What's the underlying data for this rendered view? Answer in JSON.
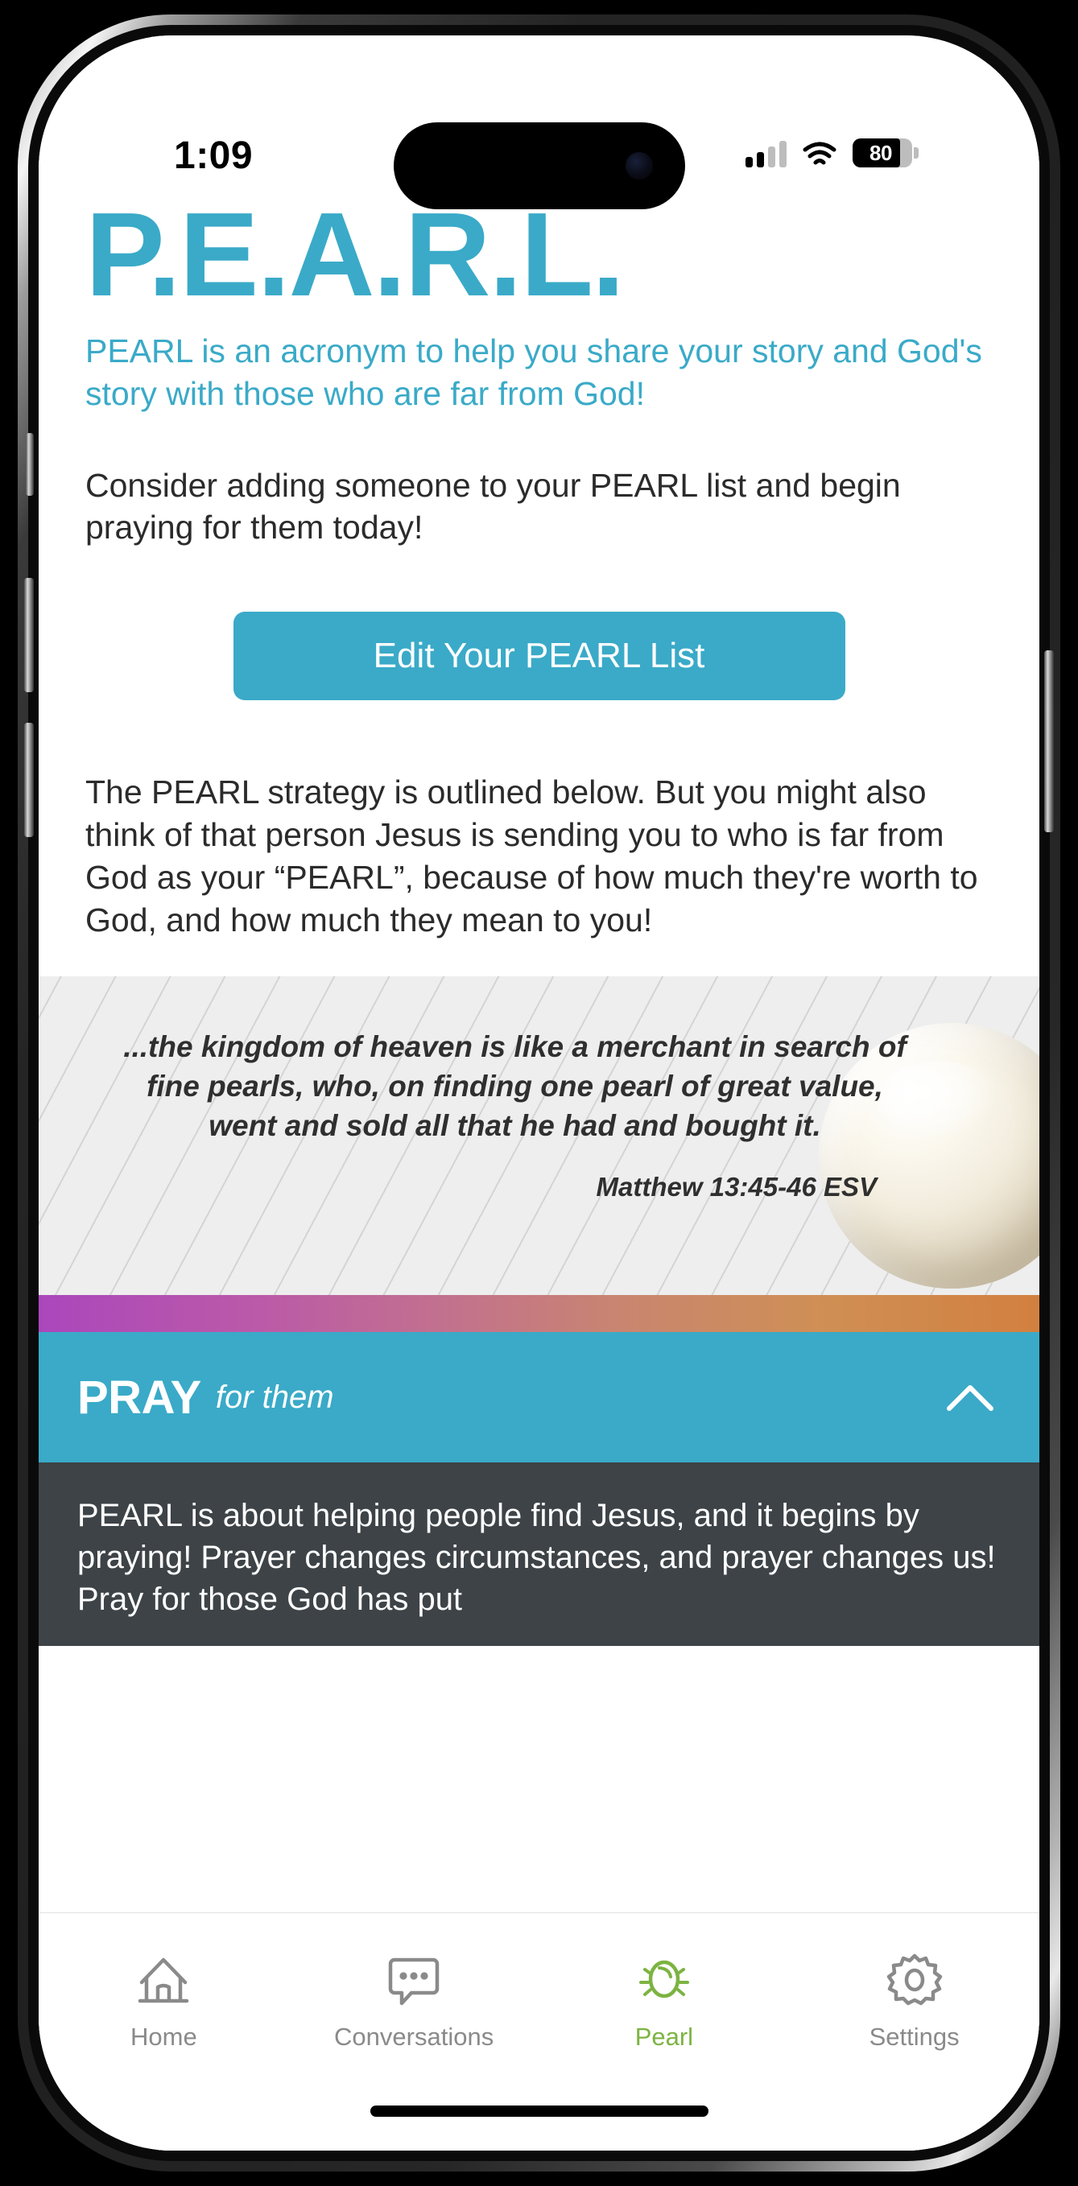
{
  "status_bar": {
    "time": "1:09",
    "battery_level": "80",
    "battery_percent": 80,
    "signal_bars_filled": 2,
    "signal_bars_total": 4,
    "icons": [
      "cellular-signal-icon",
      "wifi-icon",
      "battery-icon"
    ]
  },
  "colors": {
    "accent_teal": "#3aaac8",
    "active_green": "#7cb342",
    "dark_panel": "#3d4347",
    "scripture_bg": "#eeeeee",
    "gradient_start": "#ab47bc",
    "gradient_end": "#d28040",
    "body_text": "#2b2b2b",
    "tab_inactive": "#8a8a8a"
  },
  "main": {
    "title": "P.E.A.R.L.",
    "intro_text": "PEARL is an acronym to help you share your story and God's story with those who are far from God!",
    "consider_text": "Consider adding someone to your PEARL list and begin praying for them today!",
    "edit_button_label": "Edit Your PEARL List",
    "strategy_text": "The PEARL strategy is outlined below. But you might also think of that person Jesus is sending you to who is far from God as your “PEARL”, because of how much they're worth to God, and how much they mean to you!"
  },
  "scripture": {
    "quote": "...the kingdom of heaven is like a merchant in search of fine pearls, who, on finding one pearl of great value, went and sold all that he had and bought it.",
    "reference": "Matthew 13:45-46 ESV",
    "image": "pearl-photo"
  },
  "pray_section": {
    "heading": "PRAY",
    "subheading": "for them",
    "expanded": true,
    "chevron": "chevron-up-icon",
    "body": "PEARL is about helping people find Jesus, and it begins by praying! Prayer changes circumstances, and prayer changes us! Pray for those God has put"
  },
  "tab_bar": {
    "items": [
      {
        "label": "Home",
        "icon": "home-icon",
        "active": false
      },
      {
        "label": "Conversations",
        "icon": "chat-bubble-icon",
        "active": false
      },
      {
        "label": "Pearl",
        "icon": "pearl-glow-icon",
        "active": true
      },
      {
        "label": "Settings",
        "icon": "gear-icon",
        "active": false
      }
    ]
  }
}
